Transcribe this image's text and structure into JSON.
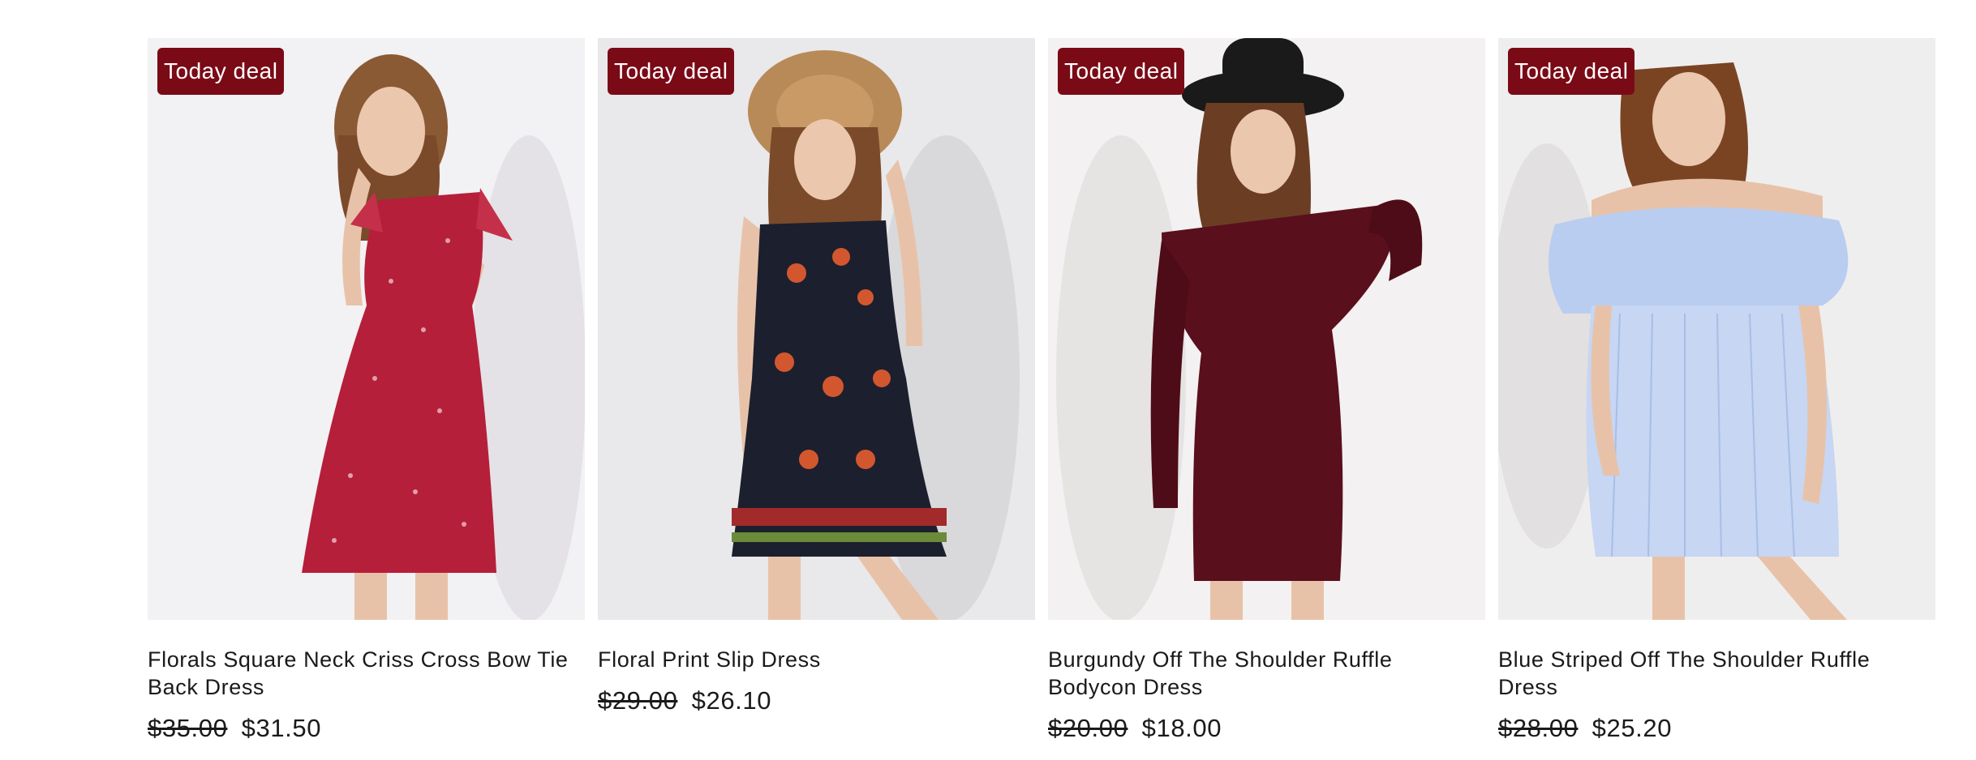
{
  "products": [
    {
      "badge": "Today deal",
      "title": "Florals Square Neck Criss Cross Bow Tie Back Dress",
      "old_price": "$35.00",
      "price": "$31.50",
      "dress_color": "#b51f3a",
      "background": "#f2f1f3",
      "image_icon": "photo-red-floral-dress"
    },
    {
      "badge": "Today deal",
      "title": "Floral Print Slip Dress",
      "old_price": "$29.00",
      "price": "$26.10",
      "dress_color": "#1c1f2e",
      "background": "#e9e8ea",
      "image_icon": "photo-floral-slip-dress"
    },
    {
      "badge": "Today deal",
      "title": "Burgundy Off The Shoulder Ruffle Bodycon Dress",
      "old_price": "$20.00",
      "price": "$18.00",
      "dress_color": "#5a0f1c",
      "background": "#f3f1f1",
      "image_icon": "photo-burgundy-dress"
    },
    {
      "badge": "Today deal",
      "title": "Blue Striped Off The Shoulder Ruffle Dress",
      "old_price": "$28.00",
      "price": "$25.20",
      "dress_color": "#b9cdf0",
      "background": "#efeeee",
      "image_icon": "photo-blue-striped-dress"
    }
  ],
  "colors": {
    "badge_bg": "#7a0a16",
    "badge_text": "#ffffff",
    "skin": "#e8c2a8",
    "hair": "#7a4a2a"
  }
}
